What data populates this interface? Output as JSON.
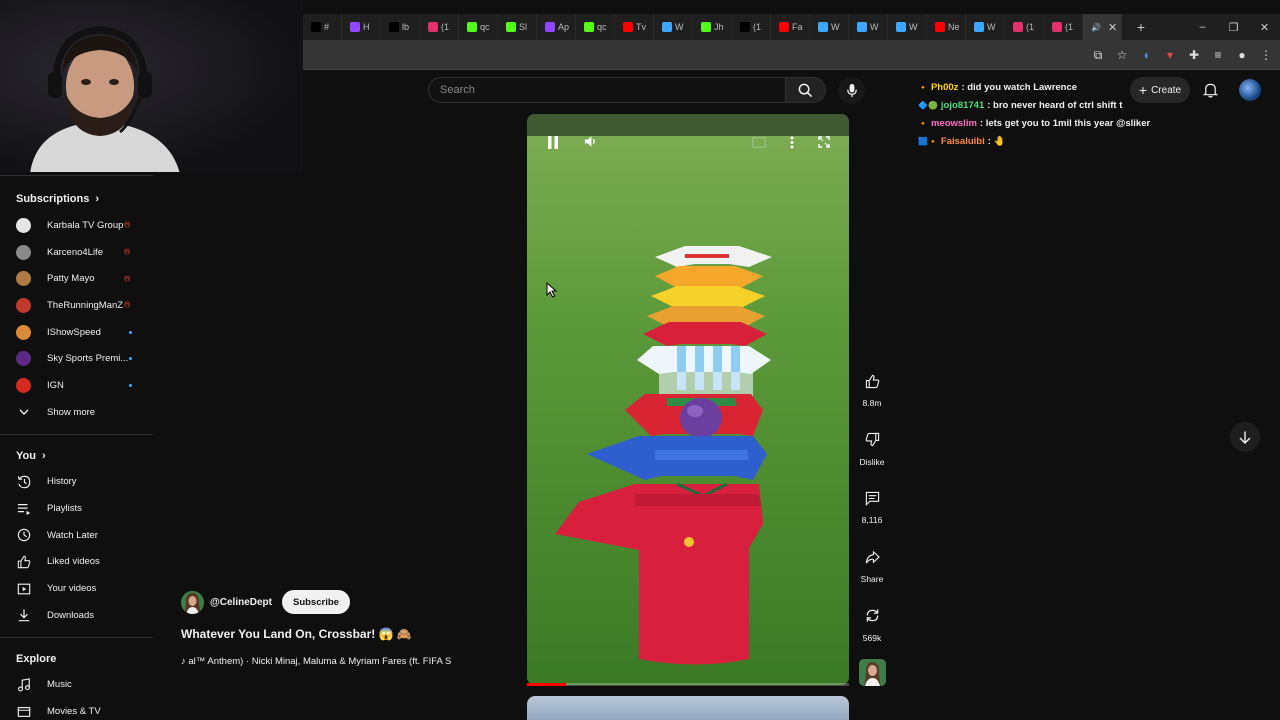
{
  "browser": {
    "tabs": [
      {
        "label": "#",
        "color": "#000000"
      },
      {
        "label": "H",
        "color": "#9146ff"
      },
      {
        "label": "lb",
        "color": "#000000"
      },
      {
        "label": "(1",
        "color": "#e1306c"
      },
      {
        "label": "qc",
        "color": "#53fc18"
      },
      {
        "label": "Sl",
        "color": "#53fc18"
      },
      {
        "label": "Ap",
        "color": "#9146ff"
      },
      {
        "label": "qc",
        "color": "#53fc18"
      },
      {
        "label": "Tv",
        "color": "#ff0000"
      },
      {
        "label": "W",
        "color": "#3ea6ff"
      },
      {
        "label": "Jh",
        "color": "#53fc18"
      },
      {
        "label": "(1",
        "color": "#000000"
      },
      {
        "label": "Fa",
        "color": "#ff0000"
      },
      {
        "label": "W",
        "color": "#3ea6ff"
      },
      {
        "label": "W",
        "color": "#3ea6ff"
      },
      {
        "label": "W",
        "color": "#3ea6ff"
      },
      {
        "label": "Ne",
        "color": "#ff0000"
      },
      {
        "label": "W",
        "color": "#3ea6ff"
      },
      {
        "label": "(1",
        "color": "#e1306c"
      },
      {
        "label": "(1",
        "color": "#e1306c"
      }
    ],
    "new_tab": "+",
    "window_controls": [
      "–",
      "❐",
      "✕"
    ]
  },
  "search": {
    "placeholder": "Search"
  },
  "header": {
    "create_label": "Create"
  },
  "chat": [
    {
      "user": "Ph00z",
      "user_color": "#ffd60a",
      "badge": "🔸",
      "message": ": did you watch Lawrence"
    },
    {
      "user": "jojo81741",
      "user_color": "#4ade80",
      "badge": "🔷🟢",
      "message": ": bro never heard of ctrl shift t"
    },
    {
      "user": "meowslim",
      "user_color": "#ff6bcb",
      "badge": "🔸",
      "message": ": lets get you to 1mil this year @sliker"
    },
    {
      "user": "Faisaluibi",
      "user_color": "#ff8c42",
      "badge": "🟦🔸",
      "message": ": 🤚"
    }
  ],
  "sidebar": {
    "subscriptions_title": "Subscriptions",
    "subscriptions": [
      {
        "name": "Karbala TV Group",
        "status": "live",
        "avatar": "#e5e5e5"
      },
      {
        "name": "Karceno4Life",
        "status": "live",
        "avatar": "#8a8a8a"
      },
      {
        "name": "Patty Mayo",
        "status": "live",
        "avatar": "#b07a45"
      },
      {
        "name": "TheRunningManZ",
        "status": "live",
        "avatar": "#c0392b"
      },
      {
        "name": "IShowSpeed",
        "status": "new",
        "avatar": "#d98b3a"
      },
      {
        "name": "Sky Sports Premi...",
        "status": "new",
        "avatar": "#5b2a86"
      },
      {
        "name": "IGN",
        "status": "new",
        "avatar": "#d52b1e"
      }
    ],
    "show_more": "Show more",
    "you_title": "You",
    "you_items": [
      {
        "label": "History",
        "icon": "history-icon"
      },
      {
        "label": "Playlists",
        "icon": "playlists-icon"
      },
      {
        "label": "Watch Later",
        "icon": "clock-icon"
      },
      {
        "label": "Liked videos",
        "icon": "thumb-up-icon"
      },
      {
        "label": "Your videos",
        "icon": "video-icon"
      },
      {
        "label": "Downloads",
        "icon": "download-icon"
      }
    ],
    "explore_title": "Explore",
    "explore_items": [
      {
        "label": "Music",
        "icon": "music-icon"
      },
      {
        "label": "Movies & TV",
        "icon": "movies-icon"
      }
    ]
  },
  "video": {
    "channel": "@CelineDept",
    "subscribe_label": "Subscribe",
    "title": "Whatever You Land On, Crossbar! 😱 🙈",
    "music": "♪ al™ Anthem) · Nicki Minaj, Maluma & Myriam Fares (ft. FIFA S",
    "progress": 0.12
  },
  "actions": {
    "likes": "8.8m",
    "dislike_label": "Dislike",
    "comments": "8,116",
    "share_label": "Share",
    "remix": "569k"
  }
}
